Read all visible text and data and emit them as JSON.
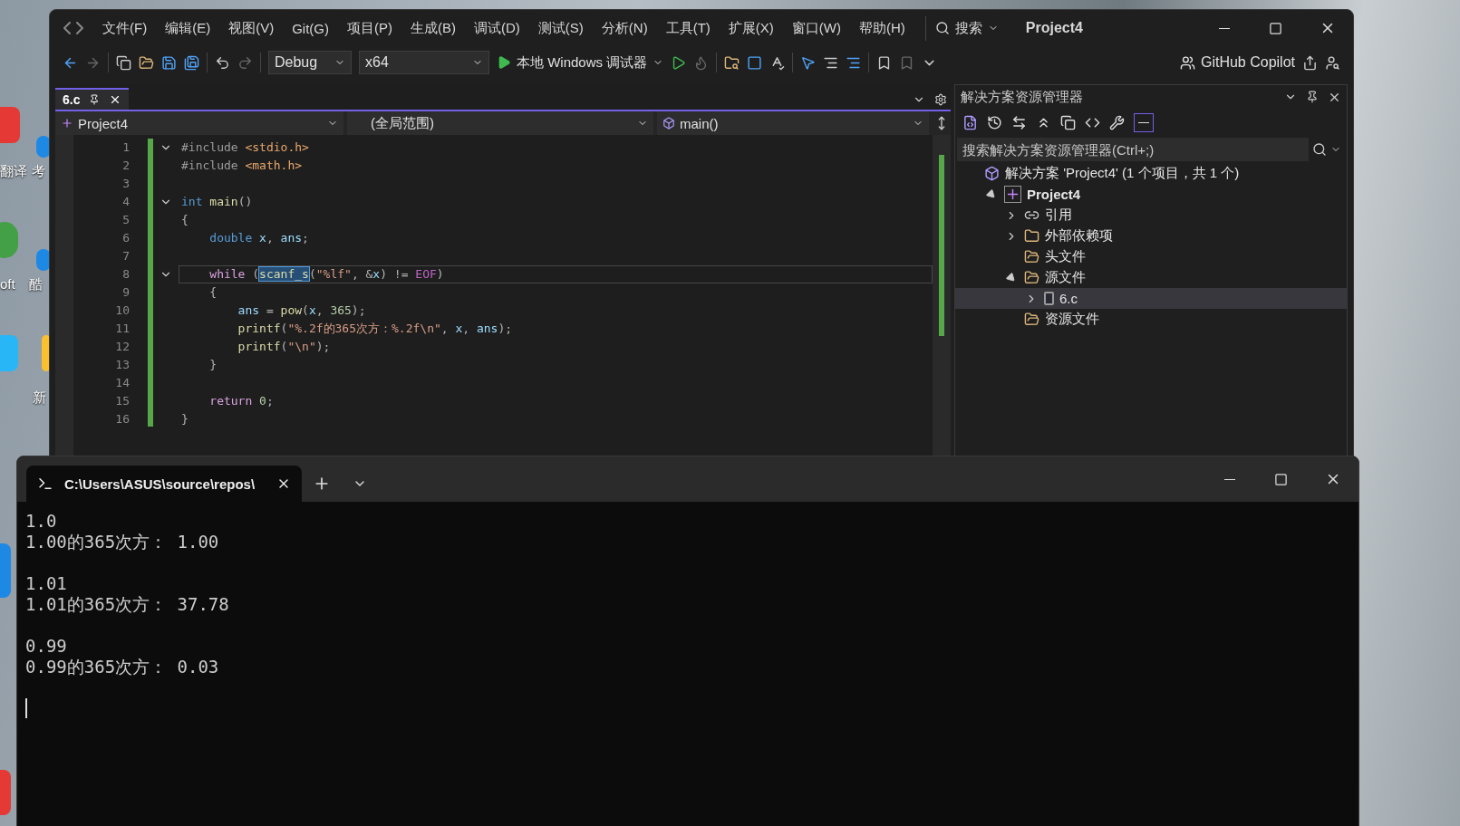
{
  "desktop": {
    "icon_labels": [
      "翻译",
      "考",
      "oft",
      "酷",
      "新"
    ]
  },
  "ide": {
    "menu": [
      "文件(F)",
      "编辑(E)",
      "视图(V)",
      "Git(G)",
      "项目(P)",
      "生成(B)",
      "调试(D)",
      "测试(S)",
      "分析(N)",
      "工具(T)",
      "扩展(X)",
      "窗口(W)",
      "帮助(H)"
    ],
    "search": "搜索",
    "title": "Project4",
    "toolbar": {
      "configuration": "Debug",
      "platform": "x64",
      "run_label": "本地 Windows 调试器",
      "copilot": "GitHub Copilot"
    },
    "document_tabs": [
      {
        "label": "6.c",
        "selected": true
      }
    ],
    "navigation": {
      "project": "Project4",
      "scope": "(全局范围)",
      "member": "main()"
    },
    "code": {
      "lines": [
        {
          "number": "1",
          "fold": true,
          "current": false,
          "tokens": [
            {
              "kind": "pre",
              "t": "#include"
            },
            {
              "kind": "inc",
              "t": " <stdio.h>"
            }
          ]
        },
        {
          "number": "2",
          "fold": false,
          "current": false,
          "tokens": [
            {
              "kind": "pre",
              "t": "#include"
            },
            {
              "kind": "inc",
              "t": " <math.h>"
            }
          ]
        },
        {
          "number": "3",
          "fold": false,
          "current": false
        },
        {
          "number": "4",
          "fold": true,
          "current": false,
          "tokens": [
            {
              "kind": "type",
              "t": "int"
            },
            {
              "kind": "func",
              "t": " main"
            },
            {
              "kind": "punc",
              "t": "()"
            }
          ]
        },
        {
          "number": "5",
          "fold": false,
          "current": false,
          "tokens": [
            {
              "kind": "punc",
              "t": "{"
            }
          ]
        },
        {
          "number": "6",
          "fold": false,
          "current": false,
          "tokens": [
            {
              "kind": "type",
              "t": "    double"
            },
            {
              "kind": "var",
              "t": " x"
            },
            {
              "kind": "punc",
              "t": ", "
            },
            {
              "kind": "var",
              "t": "ans"
            },
            {
              "kind": "punc",
              "t": ";"
            }
          ]
        },
        {
          "number": "7",
          "fold": false,
          "current": false
        },
        {
          "number": "8",
          "fold": true,
          "current": true,
          "tokens": [
            {
              "kind": "ctl",
              "t": "    while"
            },
            {
              "kind": "punc",
              "t": " ("
            },
            {
              "kind": "sel",
              "t": "scanf_s"
            },
            {
              "kind": "punc",
              "t": "("
            },
            {
              "kind": "str",
              "t": "\"%lf\""
            },
            {
              "kind": "punc",
              "t": ", &"
            },
            {
              "kind": "var",
              "t": "x"
            },
            {
              "kind": "punc",
              "t": ") != "
            },
            {
              "kind": "mac",
              "t": "EOF"
            },
            {
              "kind": "punc",
              "t": ")"
            }
          ]
        },
        {
          "number": "9",
          "fold": false,
          "current": false,
          "tokens": [
            {
              "kind": "punc",
              "t": "    {"
            }
          ]
        },
        {
          "number": "10",
          "fold": false,
          "current": false,
          "tokens": [
            {
              "kind": "var",
              "t": "        ans"
            },
            {
              "kind": "punc",
              "t": " = "
            },
            {
              "kind": "func",
              "t": "pow"
            },
            {
              "kind": "punc",
              "t": "("
            },
            {
              "kind": "var",
              "t": "x"
            },
            {
              "kind": "punc",
              "t": ", "
            },
            {
              "kind": "num",
              "t": "365"
            },
            {
              "kind": "punc",
              "t": ");"
            }
          ]
        },
        {
          "number": "11",
          "fold": false,
          "current": false,
          "tokens": [
            {
              "kind": "func",
              "t": "        printf"
            },
            {
              "kind": "punc",
              "t": "("
            },
            {
              "kind": "str",
              "t": "\"%.2f的365次方：%.2f\\n\""
            },
            {
              "kind": "punc",
              "t": ", "
            },
            {
              "kind": "var",
              "t": "x"
            },
            {
              "kind": "punc",
              "t": ", "
            },
            {
              "kind": "var",
              "t": "ans"
            },
            {
              "kind": "punc",
              "t": ");"
            }
          ]
        },
        {
          "number": "12",
          "fold": false,
          "current": false,
          "tokens": [
            {
              "kind": "func",
              "t": "        printf"
            },
            {
              "kind": "punc",
              "t": "("
            },
            {
              "kind": "str",
              "t": "\"\\n\""
            },
            {
              "kind": "punc",
              "t": ");"
            }
          ]
        },
        {
          "number": "13",
          "fold": false,
          "current": false,
          "tokens": [
            {
              "kind": "punc",
              "t": "    }"
            }
          ]
        },
        {
          "number": "14",
          "fold": false,
          "current": false
        },
        {
          "number": "15",
          "fold": false,
          "current": false,
          "tokens": [
            {
              "kind": "ctl",
              "t": "    return"
            },
            {
              "kind": "num",
              "t": " 0"
            },
            {
              "kind": "punc",
              "t": ";"
            }
          ]
        },
        {
          "number": "16",
          "fold": false,
          "current": false,
          "tokens": [
            {
              "kind": "punc",
              "t": "}"
            }
          ]
        }
      ]
    },
    "solution_explorer": {
      "title": "解决方案资源管理器",
      "search_placeholder": "搜索解决方案资源管理器(Ctrl+;)",
      "tree": [
        {
          "label": "解决方案 'Project4' (1 个项目，共 1 个)",
          "kind": "solution",
          "selected": false,
          "children": [
            {
              "label": "Project4",
              "kind": "project",
              "expanded": true,
              "selected": false,
              "children": [
                {
                  "label": "引用",
                  "kind": "references",
                  "expanded": false,
                  "selected": false
                },
                {
                  "label": "外部依赖项",
                  "kind": "external",
                  "expanded": false,
                  "selected": false
                },
                {
                  "label": "头文件",
                  "kind": "filter",
                  "selected": false
                },
                {
                  "label": "源文件",
                  "kind": "filter",
                  "expanded": true,
                  "selected": false,
                  "children": [
                    {
                      "label": "6.c",
                      "kind": "file",
                      "expanded": false,
                      "selected": true
                    }
                  ]
                },
                {
                  "label": "资源文件",
                  "kind": "filter",
                  "selected": false
                }
              ]
            }
          ]
        }
      ]
    }
  },
  "terminal": {
    "tab_title": "C:\\Users\\ASUS\\source\\repos\\",
    "output": [
      {
        "input": "1.0",
        "result": "1.00的365次方： 1.00"
      },
      {
        "input": "1.01",
        "result": "1.01的365次方： 37.78"
      },
      {
        "input": "0.99",
        "result": "0.99的365次方： 0.03"
      }
    ]
  }
}
